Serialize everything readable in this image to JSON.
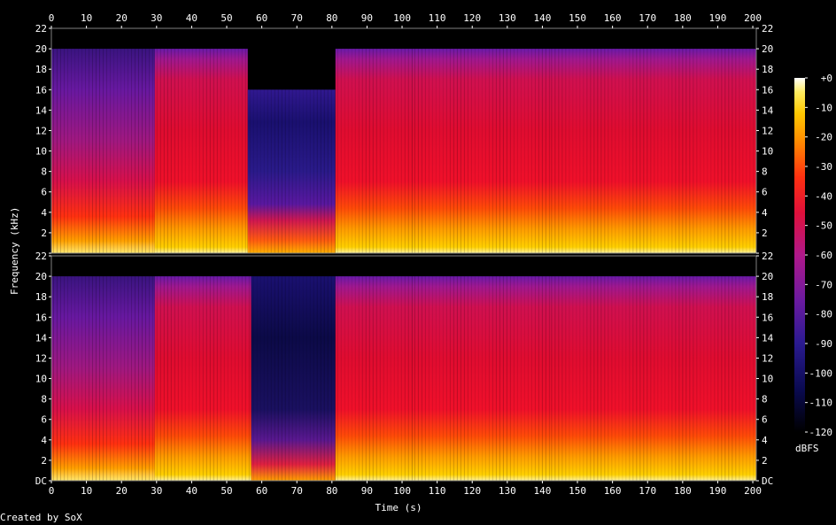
{
  "credit": "Created by SoX",
  "chart_data": {
    "type": "heatmap",
    "title": "",
    "xlabel": "Time (s)",
    "ylabel": "Frequency (kHz)",
    "xlim": [
      0,
      201
    ],
    "ylim": [
      0,
      22
    ],
    "x_ticks": [
      "0",
      "10",
      "20",
      "30",
      "40",
      "50",
      "60",
      "70",
      "80",
      "90",
      "100",
      "110",
      "120",
      "130",
      "140",
      "150",
      "160",
      "170",
      "180",
      "190",
      "200"
    ],
    "y_ticks": [
      "DC",
      "2",
      "4",
      "6",
      "8",
      "10",
      "12",
      "14",
      "16",
      "18",
      "20",
      "22"
    ],
    "channels": [
      {
        "segments": [
          {
            "t": [
              0,
              29.5
            ],
            "cutoff": 20,
            "level": "busy-quiet"
          },
          {
            "t": [
              29.5,
              56
            ],
            "cutoff": 20,
            "level": "loud"
          },
          {
            "t": [
              56,
              81
            ],
            "cutoff": 16,
            "level": "quiet"
          },
          {
            "t": [
              81,
              103
            ],
            "cutoff": 20,
            "level": "loud"
          },
          {
            "t": [
              103,
              142
            ],
            "cutoff": 20,
            "level": "loud"
          },
          {
            "t": [
              142,
              201
            ],
            "cutoff": 20,
            "level": "loud"
          }
        ]
      },
      {
        "segments": [
          {
            "t": [
              0,
              29.5
            ],
            "cutoff": 20,
            "level": "busy-quiet"
          },
          {
            "t": [
              29.5,
              57
            ],
            "cutoff": 20,
            "level": "loud"
          },
          {
            "t": [
              57,
              81
            ],
            "cutoff": 20,
            "level": "very-quiet"
          },
          {
            "t": [
              81,
              103
            ],
            "cutoff": 20,
            "level": "loud"
          },
          {
            "t": [
              103,
              142
            ],
            "cutoff": 20,
            "level": "loud"
          },
          {
            "t": [
              142,
              201
            ],
            "cutoff": 20,
            "level": "loud"
          }
        ]
      }
    ],
    "colorbar": {
      "unit": "dBFS",
      "range": [
        -120,
        0
      ],
      "ticks": [
        "+0",
        "-10",
        "-20",
        "-30",
        "-40",
        "-50",
        "-60",
        "-70",
        "-80",
        "-90",
        "-100",
        "-110",
        "-120"
      ]
    }
  }
}
